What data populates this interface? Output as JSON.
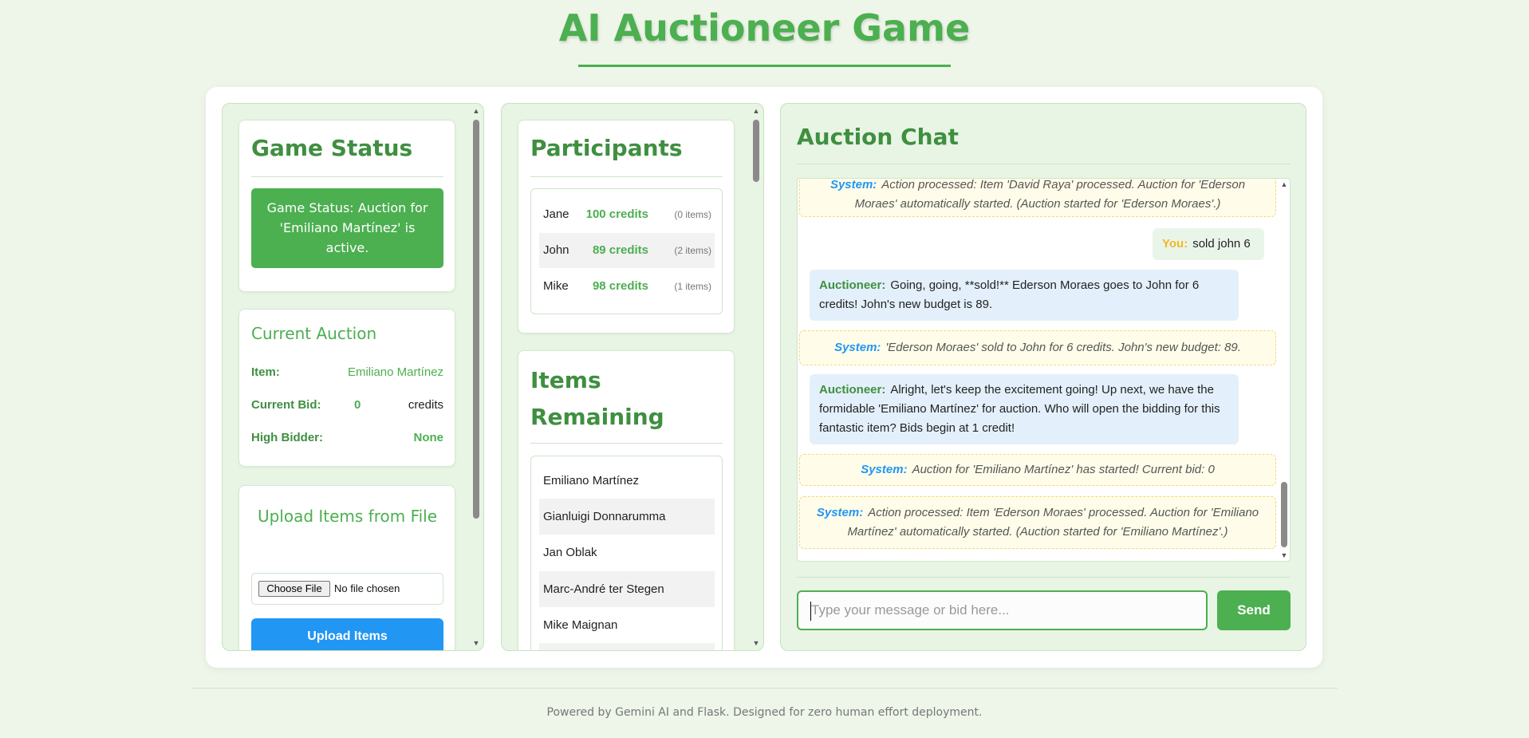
{
  "header": {
    "title": "AI Auctioneer Game"
  },
  "game_status": {
    "heading": "Game Status",
    "status_text": "Game Status: Auction for 'Emiliano Martínez' is active."
  },
  "current_auction": {
    "heading": "Current Auction",
    "item_label": "Item:",
    "item_value": "Emiliano Martínez",
    "bid_label": "Current Bid:",
    "bid_value": "0",
    "bid_unit": "credits",
    "bidder_label": "High Bidder:",
    "bidder_value": "None"
  },
  "upload": {
    "heading": "Upload Items from File",
    "choose_label": "Choose File",
    "file_status": "No file chosen",
    "button_label": "Upload Items"
  },
  "participants": {
    "heading": "Participants",
    "rows": [
      {
        "name": "Jane",
        "credits": "100 credits",
        "items": "(0 items)"
      },
      {
        "name": "John",
        "credits": "89 credits",
        "items": "(2 items)"
      },
      {
        "name": "Mike",
        "credits": "98 credits",
        "items": "(1 items)"
      }
    ]
  },
  "items_remaining": {
    "heading_line1": "Items",
    "heading_line2": "Remaining",
    "items": [
      "Emiliano Martínez",
      "Gianluigi Donnarumma",
      "Jan Oblak",
      "Marc-André ter Stegen",
      "Mike Maignan"
    ]
  },
  "chat": {
    "heading": "Auction Chat",
    "messages": [
      {
        "who": "System:",
        "text1": "Action processed: Item 'David Raya' processed. Auction for 'Ederson",
        "text2": "Moraes' automatically started. (Auction started for 'Ederson Moraes'.)"
      },
      {
        "who": "You:",
        "text1": "sold john 6"
      },
      {
        "who": "Auctioneer:",
        "text1": "Going, going, **sold!** Ederson Moraes goes to John for 6",
        "text2": "credits! John's new budget is 89."
      },
      {
        "who": "System:",
        "text1": "'Ederson Moraes' sold to John for 6 credits. John's new budget: 89."
      },
      {
        "who": "Auctioneer:",
        "text1": "Alright, let's keep the excitement going! Up next, we have the",
        "text2": "formidable 'Emiliano Martínez' for auction. Who will open the bidding for this",
        "text3": "fantastic item? Bids begin at 1 credit!"
      },
      {
        "who": "System:",
        "text1": "Auction for 'Emiliano Martínez' has started! Current bid: 0"
      },
      {
        "who": "System:",
        "text1": "Action processed: Item 'Ederson Moraes' processed. Auction for 'Emiliano",
        "text2": "Martínez' automatically started. (Auction started for 'Emiliano Martínez'.)"
      }
    ],
    "input_placeholder": "Type your message or bid here...",
    "send_label": "Send"
  },
  "footer": {
    "text": "Powered by Gemini AI and Flask. Designed for zero human effort deployment."
  },
  "colors": {
    "accent": "#4caf50",
    "upload_button": "#2196f3",
    "system_label": "#2196f3",
    "user_label": "#f2b824"
  }
}
